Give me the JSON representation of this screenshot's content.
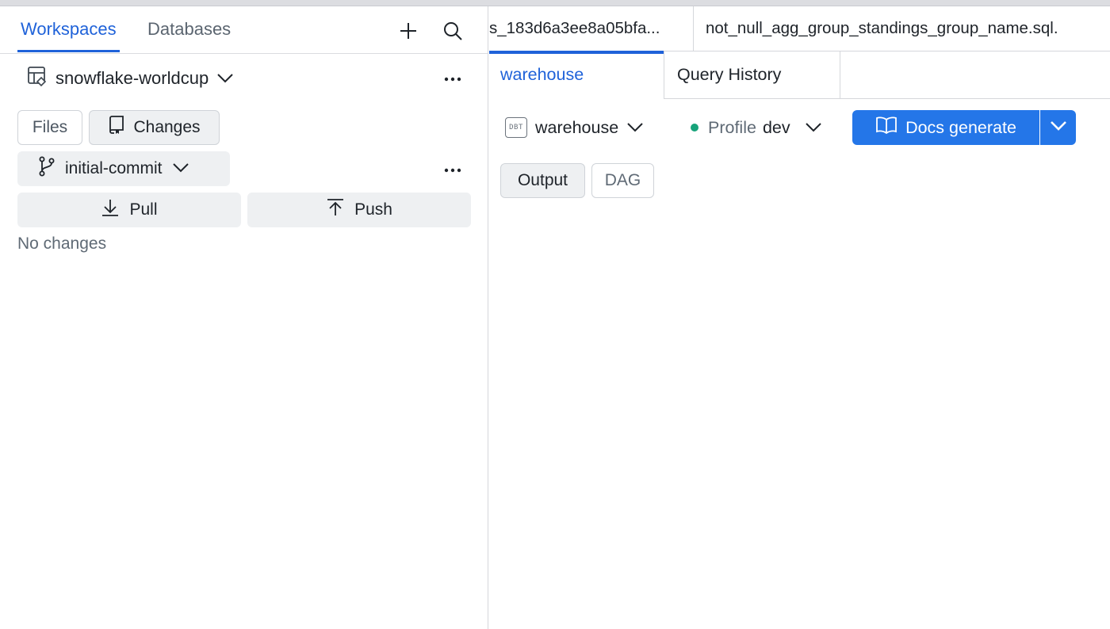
{
  "sidebar": {
    "tabs": [
      {
        "label": "Workspaces",
        "active": true
      },
      {
        "label": "Databases",
        "active": false
      }
    ],
    "workspace_name": "snowflake-worldcup",
    "view_buttons": {
      "files": "Files",
      "changes": "Changes"
    },
    "branch": "initial-commit",
    "pull_label": "Pull",
    "push_label": "Push",
    "status_text": "No changes"
  },
  "editor": {
    "file_tabs": [
      {
        "label": "s_183d6a3ee8a05bfa..."
      },
      {
        "label": "not_null_agg_group_standings_group_name.sql."
      }
    ]
  },
  "panel": {
    "tabs": [
      {
        "label": "warehouse",
        "active": true
      },
      {
        "label": "Query History",
        "active": false
      }
    ],
    "project_badge": "DBT",
    "project": "warehouse",
    "profile_label": "Profile",
    "profile_value": "dev",
    "action_button": "Docs generate",
    "output_tabs": [
      {
        "label": "Output",
        "active": true
      },
      {
        "label": "DAG",
        "active": false
      }
    ]
  },
  "colors": {
    "accent": "#1f62d9",
    "primary_button": "#2476e8",
    "status_dot": "#17a37a"
  },
  "icons": [
    "plus-icon",
    "search-icon",
    "workspace-icon",
    "chevron-down-icon",
    "more-icon",
    "changes-icon",
    "git-branch-icon",
    "download-icon",
    "upload-icon",
    "book-icon"
  ]
}
